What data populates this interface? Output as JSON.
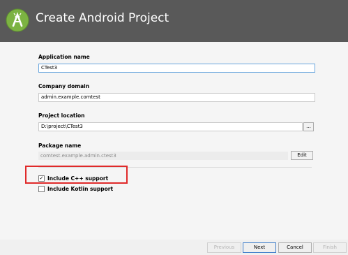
{
  "header": {
    "title": "Create Android Project",
    "logo_icon": "android-studio-logo-icon",
    "background": "#595959"
  },
  "form": {
    "app_name_label": "Application name",
    "app_name_value": "CTest3",
    "company_label": "Company domain",
    "company_value": "admin.example.comtest",
    "location_label": "Project location",
    "location_value": "D:\\project\\CTest3",
    "browse_label": "...",
    "package_label": "Package name",
    "package_value": "comtest.example.admin.ctest3",
    "edit_label": "Edit",
    "cpp_label": "Include C++ support",
    "cpp_checked": true,
    "kotlin_label": "Include Kotlin support",
    "kotlin_checked": false
  },
  "footer": {
    "previous_label": "Previous",
    "next_label": "Next",
    "cancel_label": "Cancel",
    "finish_label": "Finish"
  },
  "colors": {
    "highlight": "#e02a2a",
    "focus": "#6aa7de"
  }
}
